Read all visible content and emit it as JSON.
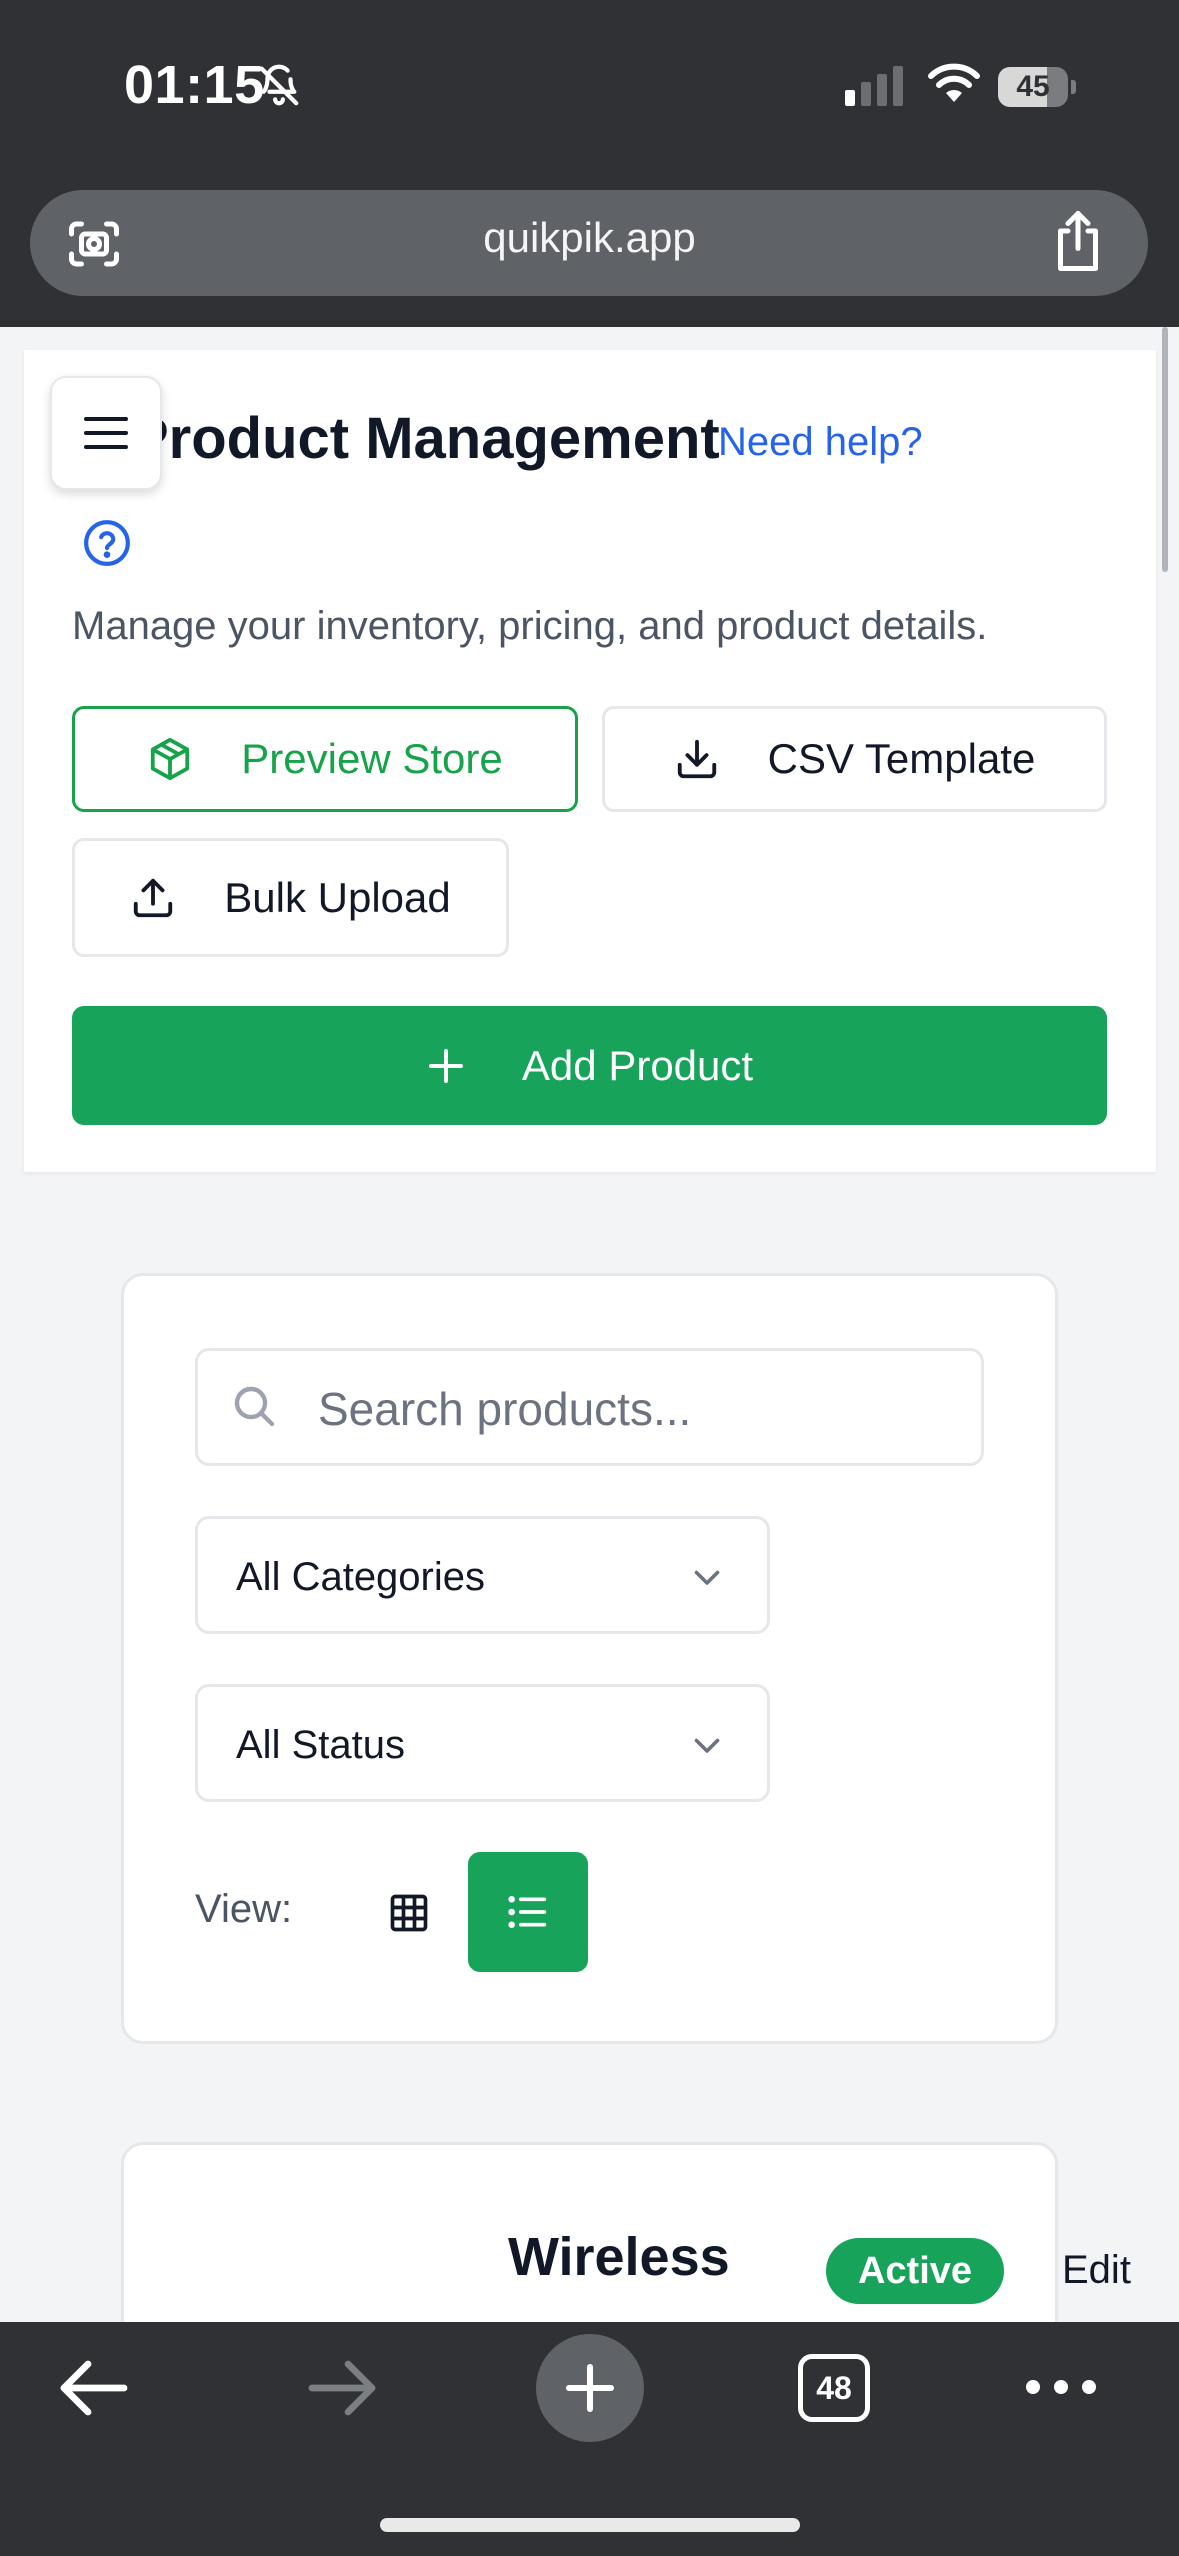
{
  "status_bar": {
    "time": "01:15",
    "battery": "45"
  },
  "browser": {
    "url": "quikpik.app",
    "tab_count": "48"
  },
  "header": {
    "title": "Product Management",
    "help_link": "Need help?",
    "subtitle": "Manage your inventory, pricing, and product details."
  },
  "actions": {
    "preview_store": "Preview Store",
    "csv_template": "CSV Template",
    "bulk_upload": "Bulk Upload",
    "add_product": "Add Product"
  },
  "filters": {
    "search_placeholder": "Search products...",
    "category_selected": "All Categories",
    "status_selected": "All Status",
    "view_label": "View:",
    "active_view": "list"
  },
  "products": [
    {
      "name": "Wireless",
      "status": "Active",
      "edit_label": "Edit"
    }
  ],
  "colors": {
    "brand_green": "#17a35a",
    "link_blue": "#2563eb",
    "chrome_dark": "#2f3134"
  }
}
